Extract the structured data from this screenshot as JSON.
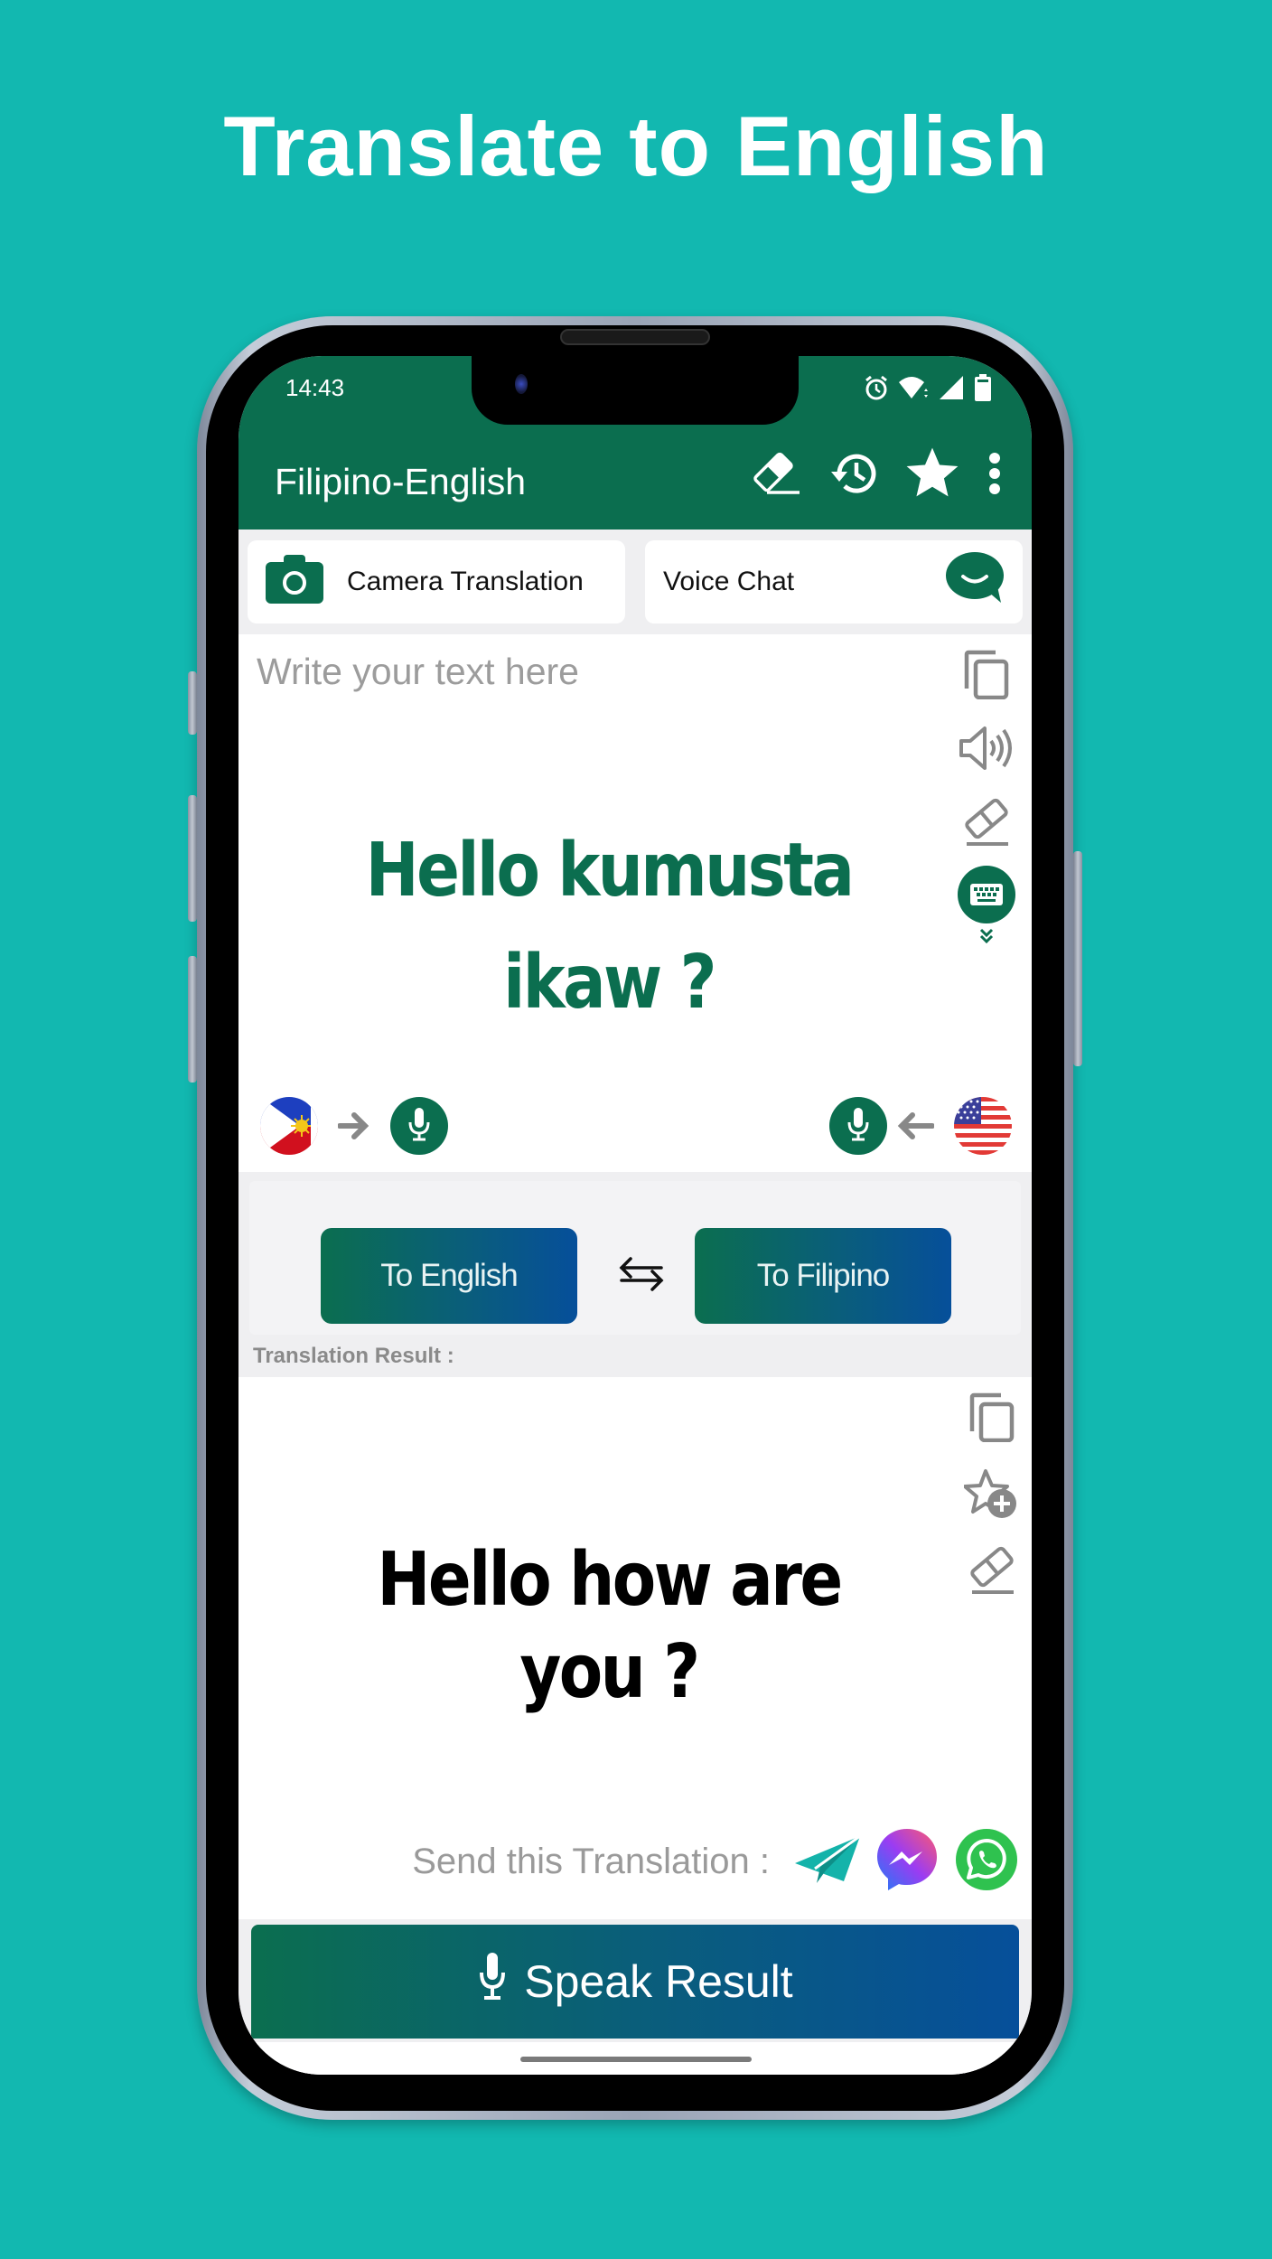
{
  "promo": {
    "headline": "Translate to English"
  },
  "status_bar": {
    "time": "14:43",
    "icons": [
      "alarm-icon",
      "wifi-icon",
      "signal-icon",
      "battery-icon"
    ]
  },
  "app_bar": {
    "title": "Filipino-English",
    "actions": [
      {
        "name": "eraser-icon",
        "label": "Clear"
      },
      {
        "name": "history-icon",
        "label": "History"
      },
      {
        "name": "star-icon",
        "label": "Favorites"
      },
      {
        "name": "more-vert-icon",
        "label": "More"
      }
    ]
  },
  "features": {
    "camera_label": "Camera Translation",
    "voice_chat_label": "Voice Chat"
  },
  "input": {
    "placeholder": "Write your text here",
    "text": "Hello kumusta ikaw ?",
    "tools": [
      "copy-icon",
      "speaker-icon",
      "eraser-icon",
      "keyboard-icon"
    ]
  },
  "mic_row": {
    "source_flag": "Philippines",
    "target_flag": "United States"
  },
  "translate": {
    "to_english_label": "To English",
    "to_filipino_label": "To Filipino",
    "result_label": "Translation Result :"
  },
  "result": {
    "text": "Hello how are you ?",
    "tools": [
      "copy-icon",
      "add-favorite-icon",
      "eraser-icon"
    ],
    "send_label": "Send this Translation :",
    "share_targets": [
      "Share",
      "Messenger",
      "WhatsApp"
    ]
  },
  "speak": {
    "label": "Speak Result"
  },
  "colors": {
    "background": "#12b8b0",
    "primary": "#0b6e4f",
    "gradient_end": "#064f9a",
    "icon_gray": "#8a8a8a"
  }
}
